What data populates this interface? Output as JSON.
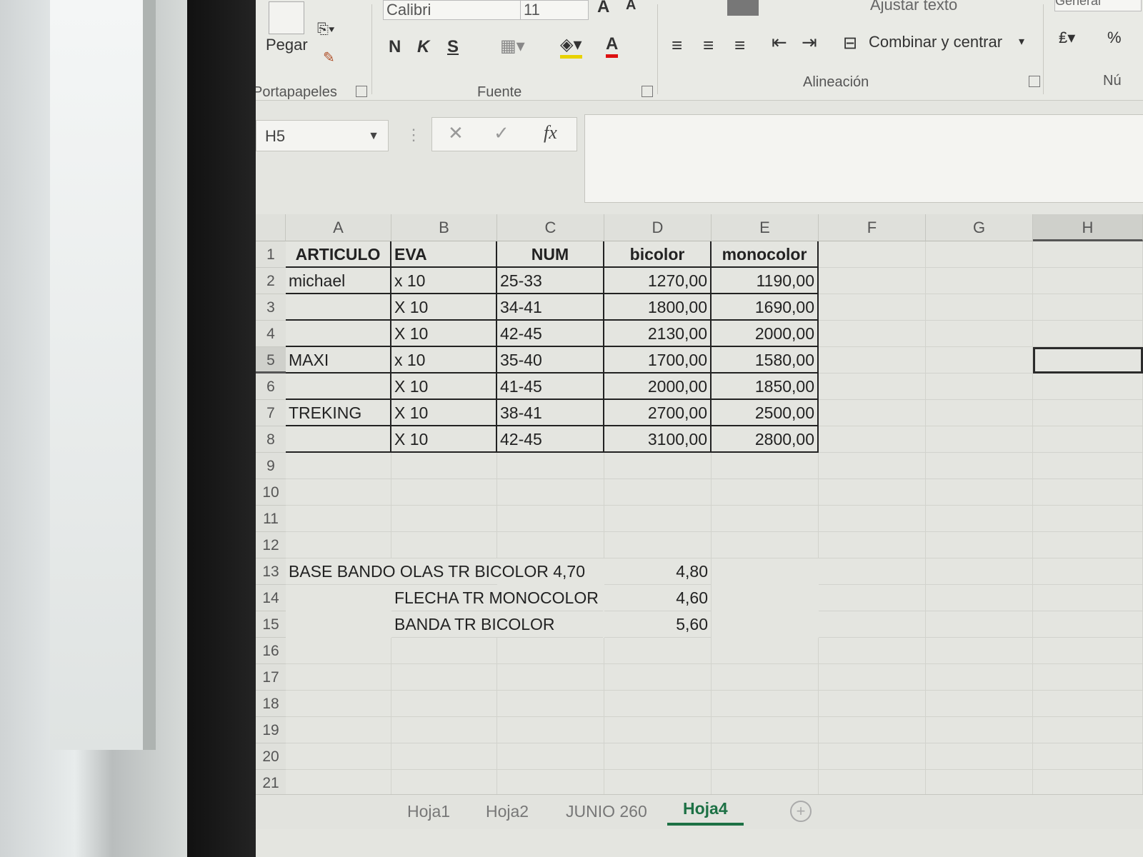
{
  "ribbon": {
    "paste_label": "Pegar",
    "clipboard_group": "Portapapeles",
    "font_group": "Fuente",
    "alignment_group": "Alineación",
    "number_group": "Nú",
    "font_name": "Calibri",
    "font_size": "11",
    "bold_label": "N",
    "italic_label": "K",
    "underline_label": "S",
    "font_color_label": "A",
    "grow_font_label": "A",
    "shrink_font_label": "A",
    "wrap_text_label": "Ajustar texto",
    "merge_center_label": "Combinar y centrar",
    "number_format_label": "General",
    "percent_label": "%"
  },
  "formula_bar": {
    "name_box": "H5",
    "cancel_symbol": "✕",
    "enter_symbol": "✓",
    "fx_label": "fx",
    "formula_value": ""
  },
  "grid": {
    "columns": [
      "A",
      "B",
      "C",
      "D",
      "E",
      "F",
      "G",
      "H"
    ],
    "rows": [
      "1",
      "2",
      "3",
      "4",
      "5",
      "6",
      "7",
      "8",
      "9",
      "10",
      "11",
      "12",
      "13",
      "14",
      "15",
      "16",
      "17",
      "18",
      "19",
      "20",
      "21"
    ],
    "header": {
      "a": "ARTICULO",
      "b": "EVA",
      "c": "NUM",
      "d": "bicolor",
      "e": "monocolor"
    },
    "table_rows": [
      {
        "a": "michael",
        "b": "x 10",
        "c": "25-33",
        "d": "1270,00",
        "e": "1190,00"
      },
      {
        "a": "",
        "b": "X 10",
        "c": "34-41",
        "d": "1800,00",
        "e": "1690,00"
      },
      {
        "a": "",
        "b": "X 10",
        "c": "42-45",
        "d": "2130,00",
        "e": "2000,00"
      },
      {
        "a": "MAXI",
        "b": "x 10",
        "c": "35-40",
        "d": "1700,00",
        "e": "1580,00"
      },
      {
        "a": "",
        "b": "X 10",
        "c": "41-45",
        "d": "2000,00",
        "e": "1850,00"
      },
      {
        "a": "TREKING",
        "b": "X 10",
        "c": "38-41",
        "d": "2700,00",
        "e": "2500,00"
      },
      {
        "a": "",
        "b": "X 10",
        "c": "42-45",
        "d": "3100,00",
        "e": "2800,00"
      }
    ],
    "notes": [
      {
        "text": "BASE BANDO  OLAS TR BICOLOR 4,70",
        "value": "4,80"
      },
      {
        "text": "FLECHA TR MONOCOLOR",
        "value": "4,60"
      },
      {
        "text": "BANDA TR  BICOLOR",
        "value": "5,60"
      }
    ]
  },
  "sheet_tabs": [
    "Hoja1",
    "Hoja2",
    "JUNIO 260",
    "Hoja4"
  ],
  "colors": {
    "active_tab": "#1d7145",
    "grid_line": "#d2d3cd",
    "table_border": "#222222"
  }
}
